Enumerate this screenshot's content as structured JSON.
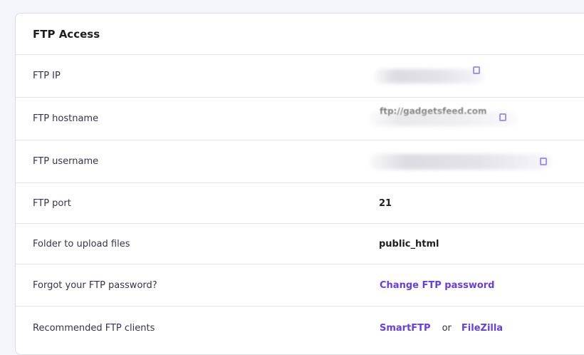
{
  "card": {
    "title": "FTP Access"
  },
  "rows": [
    {
      "label": "FTP IP",
      "value": ""
    },
    {
      "label": "FTP hostname",
      "value": "ftp://gadgetsfeed.com"
    },
    {
      "label": "FTP username",
      "value": ""
    },
    {
      "label": "FTP port",
      "value": "21"
    },
    {
      "label": "Folder to upload files",
      "value": "public_html"
    },
    {
      "label": "Forgot your FTP password?",
      "link": "Change FTP password"
    },
    {
      "label": "Recommended FTP clients",
      "link_a": "SmartFTP",
      "separator": "or",
      "link_b": "FileZilla"
    }
  ],
  "icons": {
    "copy": "copy-icon"
  },
  "colors": {
    "accent": "#673de6",
    "text": "#1d1e20",
    "border": "#e3e3ec",
    "background": "#f4f4fb"
  }
}
